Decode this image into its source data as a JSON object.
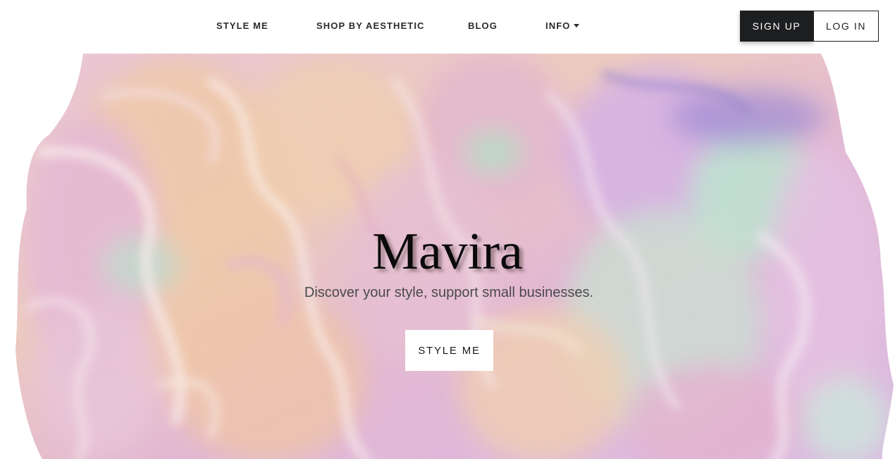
{
  "nav": {
    "links": [
      {
        "label": "STYLE ME"
      },
      {
        "label": "SHOP BY AESTHETIC"
      },
      {
        "label": "BLOG"
      },
      {
        "label": "INFO"
      }
    ],
    "info_icon": "caret-down-icon",
    "signup_label": "SIGN UP",
    "login_label": "LOG IN"
  },
  "hero": {
    "title": "Mavira",
    "tagline": "Discover your style, support small businesses.",
    "cta_label": "STYLE ME",
    "background_image": "iridescent pastel holographic blob"
  },
  "colors": {
    "signup_bg": "#1d1e20",
    "signup_text": "#ffffff",
    "text_dark": "#2b2b2b",
    "pastel_pink": "#e9b9d6",
    "pastel_lavender": "#c9a6dd",
    "pastel_mint": "#b9e2cf",
    "pastel_peach": "#f2c7a6"
  }
}
